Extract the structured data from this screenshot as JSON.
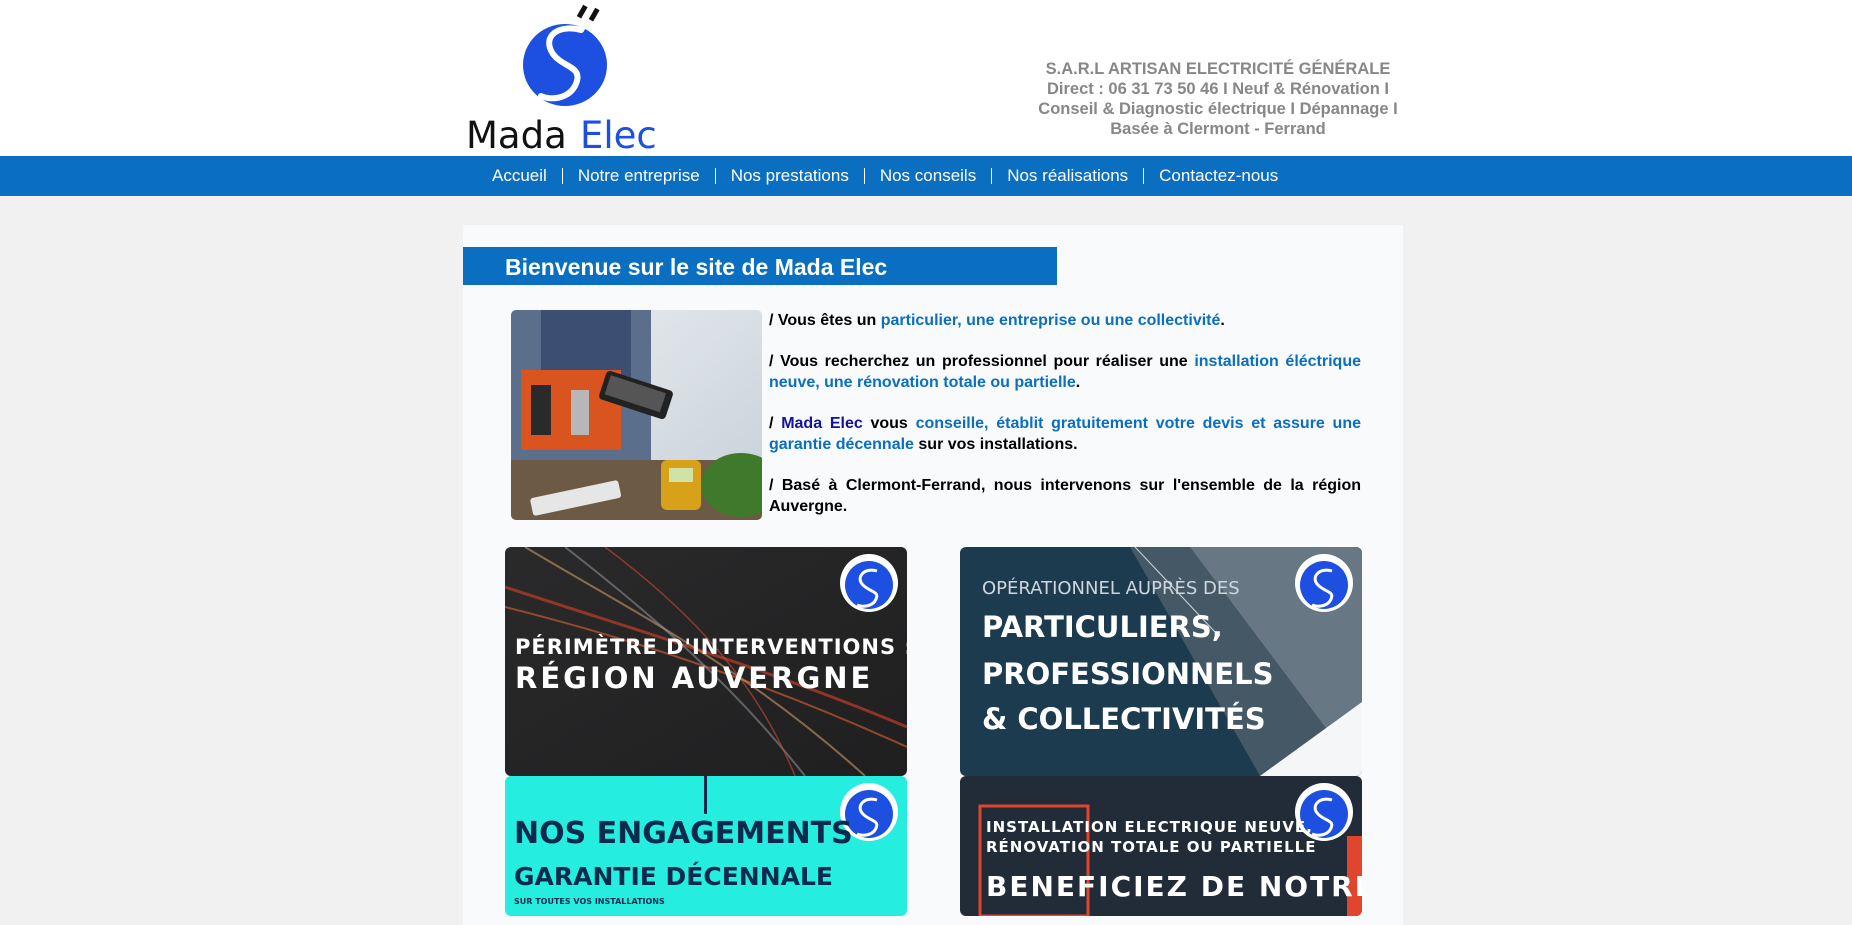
{
  "header": {
    "logo_text": "Mada Elec",
    "tagline": [
      "S.A.R.L ARTISAN ELECTRICITÉ GÉNÉRALE",
      "Direct : 06 31 73 50 46 I Neuf & Rénovation I",
      "Conseil & Diagnostic électrique I Dépannage I",
      "Basée à Clermont - Ferrand"
    ]
  },
  "nav": {
    "items": [
      "Accueil",
      "Notre entreprise",
      "Nos prestations",
      "Nos conseils",
      "Nos réalisations",
      "Contactez-nous"
    ]
  },
  "welcome": {
    "title": "Bienvenue sur le site de Mada Elec"
  },
  "intro": {
    "p1": {
      "a": "/ Vous êtes un ",
      "b": "particulier, une entreprise ou une collectivité",
      "c": "."
    },
    "p2": {
      "a": "/ Vous recherchez un professionnel pour réaliser une ",
      "b": "installation éléctrique neuve, une rénovation totale ou partielle",
      "c": "."
    },
    "p3": {
      "a": "/ ",
      "brand": "Mada Elec",
      "b": " vous ",
      "c": "conseille, établit gratuitement votre devis et assure une garantie décennale",
      "d": " sur vos installations."
    },
    "p4": "/ Basé à Clermont-Ferrand, nous intervenons sur l'ensemble de la région Auvergne."
  },
  "tiles": {
    "t1": {
      "line1": "PÉRIMÈTRE D'INTERVENTIONS :",
      "line2": "RÉGION AUVERGNE"
    },
    "t2": {
      "line1": "OPÉRATIONNEL AUPRÈS DES",
      "line2": "PARTICULIERS,",
      "line3": "PROFESSIONNELS",
      "line4": "& COLLECTIVITÉS"
    },
    "t3": {
      "line1": "NOS ENGAGEMENTS",
      "line2": "GARANTIE DÉCENNALE",
      "line3": "SUR TOUTES VOS INSTALLATIONS"
    },
    "t4": {
      "line1": "INSTALLATION ELECTRIQUE NEUVE,",
      "line2": "RÉNOVATION TOTALE OU PARTIELLE",
      "line3": "BENEFICIEZ DE NOTRE"
    }
  },
  "colors": {
    "nav_blue": "#0a6fc0",
    "brand_dark_blue": "#12129a",
    "logo_blue": "#1d4fe0"
  }
}
